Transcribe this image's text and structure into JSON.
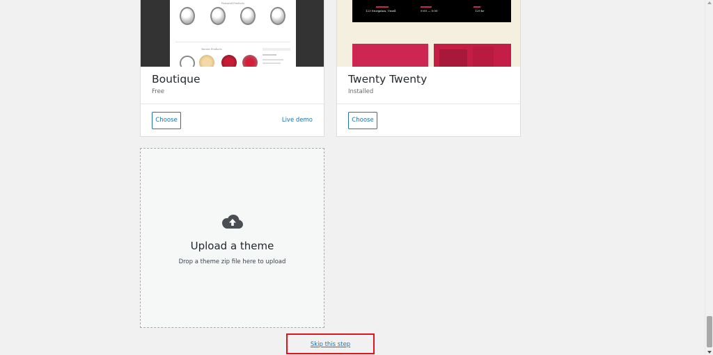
{
  "themes": [
    {
      "name": "Boutique",
      "status": "Free",
      "choose_label": "Choose",
      "demo_label": "Live demo",
      "preview": {
        "section_featured": "Featured Products",
        "section_recent": "Recent Products"
      }
    },
    {
      "name": "Twenty Twenty",
      "status": "Installed",
      "choose_label": "Choose",
      "preview": {
        "address": "123 Storgatan, Umeå",
        "hours": "9:00 — 5:00",
        "price": "129 kr"
      }
    }
  ],
  "upload": {
    "icon": "cloud-upload-icon",
    "title": "Upload a theme",
    "description": "Drop a theme zip file here to upload"
  },
  "skip": {
    "label": "Skip this step",
    "highlight_color": "#e1141d"
  },
  "colors": {
    "accent": "#2271b1",
    "twenty_red": "#cd2653",
    "background": "#f1f1f1"
  }
}
